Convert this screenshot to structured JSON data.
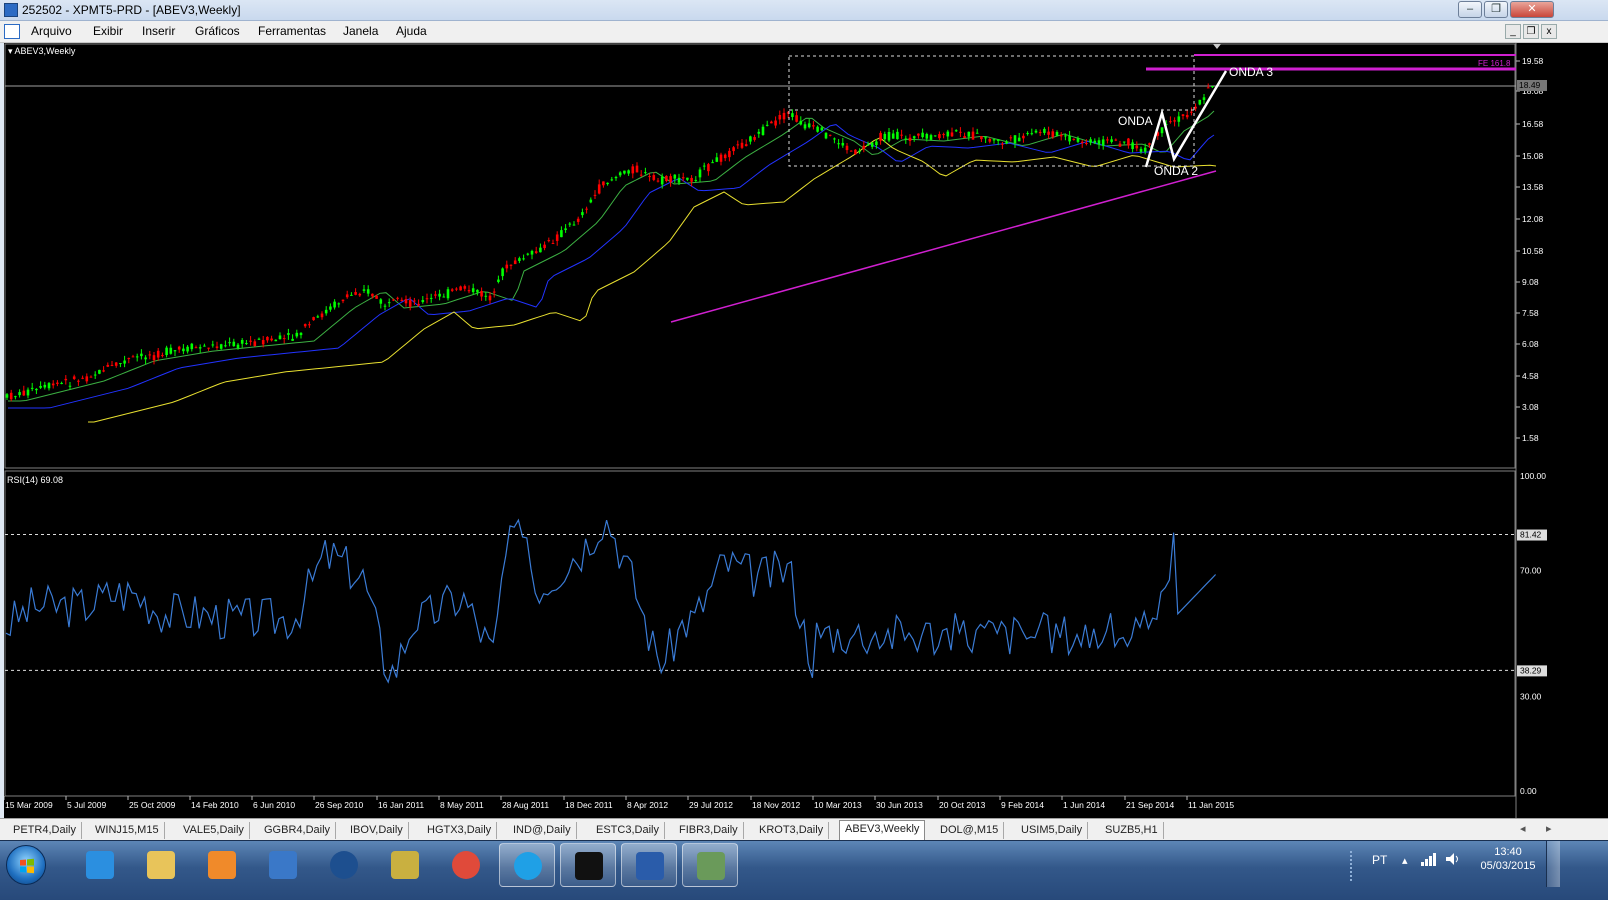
{
  "window": {
    "title": "252502 - XPMT5-PRD - [ABEV3,Weekly]"
  },
  "menu": {
    "items": [
      "Arquivo",
      "Exibir",
      "Inserir",
      "Gráficos",
      "Ferramentas",
      "Janela",
      "Ajuda"
    ]
  },
  "main_chart": {
    "symbol_label": "ABEV3,Weekly",
    "price_axis_labels": [
      "19.58",
      "18.08",
      "16.58",
      "15.08",
      "13.58",
      "12.08",
      "10.58",
      "9.08",
      "7.58",
      "6.08",
      "4.58",
      "3.08",
      "1.58"
    ],
    "current_price": "18.49",
    "fib_label": "FE 161.8",
    "annotations": [
      "ONDA",
      "ONDA 2",
      "ONDA 3"
    ]
  },
  "rsi_panel": {
    "label": "RSI(14) 69.08",
    "axis_labels": [
      "100.00",
      "81.42",
      "70.00",
      "38.29",
      "30.00",
      "0.00"
    ]
  },
  "time_axis": {
    "labels": [
      "15 Mar 2009",
      "5 Jul 2009",
      "25 Oct 2009",
      "14 Feb 2010",
      "6 Jun 2010",
      "26 Sep 2010",
      "16 Jan 2011",
      "8 May 2011",
      "28 Aug 2011",
      "18 Dec 2011",
      "8 Apr 2012",
      "29 Jul 2012",
      "18 Nov 2012",
      "10 Mar 2013",
      "30 Jun 2013",
      "20 Oct 2013",
      "9 Feb 2014",
      "1 Jun 2014",
      "21 Sep 2014",
      "11 Jan 2015"
    ]
  },
  "chart_tabs": [
    "PETR4,Daily",
    "WINJ15,M15",
    "VALE5,Daily",
    "GGBR4,Daily",
    "IBOV,Daily",
    "HGTX3,Daily",
    "IND@,Daily",
    "ESTC3,Daily",
    "FIBR3,Daily",
    "KROT3,Daily",
    "ABEV3,Weekly",
    "DOL@,M15",
    "USIM5,Daily",
    "SUZB5,H1"
  ],
  "active_tab": "ABEV3,Weekly",
  "taskbar": {
    "apps": [
      "internet-explorer",
      "file-explorer",
      "media-player",
      "mt5-terminal",
      "hp-utility",
      "file-manager",
      "chrome",
      "skype",
      "xp-investimentos",
      "word",
      "chart-app"
    ],
    "tray_language": "PT",
    "clock_time": "13:40",
    "clock_date": "05/03/2015"
  },
  "colors": {
    "bull": "#00ff00",
    "bear": "#ff0000",
    "ma_fast": "#3cb043",
    "ma_mid": "#2233ff",
    "ma_slow": "#e8e030",
    "trendline": "#d020d0",
    "rsi": "#3a7bd5"
  }
}
